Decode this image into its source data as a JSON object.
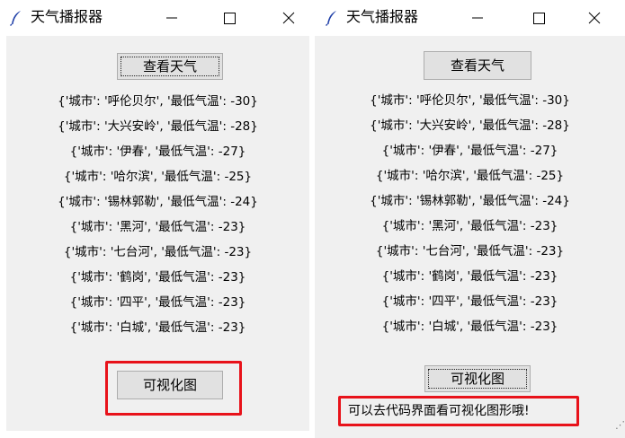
{
  "left_window": {
    "title": "天气播报器",
    "query_button": "查看天气",
    "rows": [
      "{'城市': '呼伦贝尔', '最低气温': -30}",
      "{'城市': '大兴安岭', '最低气温': -28}",
      "{'城市': '伊春', '最低气温': -27}",
      "{'城市': '哈尔滨', '最低气温': -25}",
      "{'城市': '锡林郭勒', '最低气温': -24}",
      "{'城市': '黑河', '最低气温': -23}",
      "{'城市': '七台河', '最低气温': -23}",
      "{'城市': '鹤岗', '最低气温': -23}",
      "{'城市': '四平', '最低气温': -23}",
      "{'城市': '白城', '最低气温': -23}"
    ],
    "visualize_button": "可视化图"
  },
  "right_window": {
    "title": "天气播报器",
    "query_button": "查看天气",
    "rows": [
      "{'城市': '呼伦贝尔', '最低气温': -30}",
      "{'城市': '大兴安岭', '最低气温': -28}",
      "{'城市': '伊春', '最低气温': -27}",
      "{'城市': '哈尔滨', '最低气温': -25}",
      "{'城市': '锡林郭勒', '最低气温': -24}",
      "{'城市': '黑河', '最低气温': -23}",
      "{'城市': '七台河', '最低气温': -23}",
      "{'城市': '鹤岗', '最低气温': -23}",
      "{'城市': '四平', '最低气温': -23}",
      "{'城市': '白城', '最低气温': -23}"
    ],
    "visualize_button": "可视化图",
    "message": "可以去代码界面看可视化图形哦!"
  },
  "icons": {
    "app": "feather-icon",
    "minimize": "minimize-icon",
    "maximize": "maximize-icon",
    "close": "close-icon"
  },
  "colors": {
    "highlight": "#e8121a",
    "client_bg": "#f0f0f0",
    "button_bg": "#e1e1e1"
  }
}
